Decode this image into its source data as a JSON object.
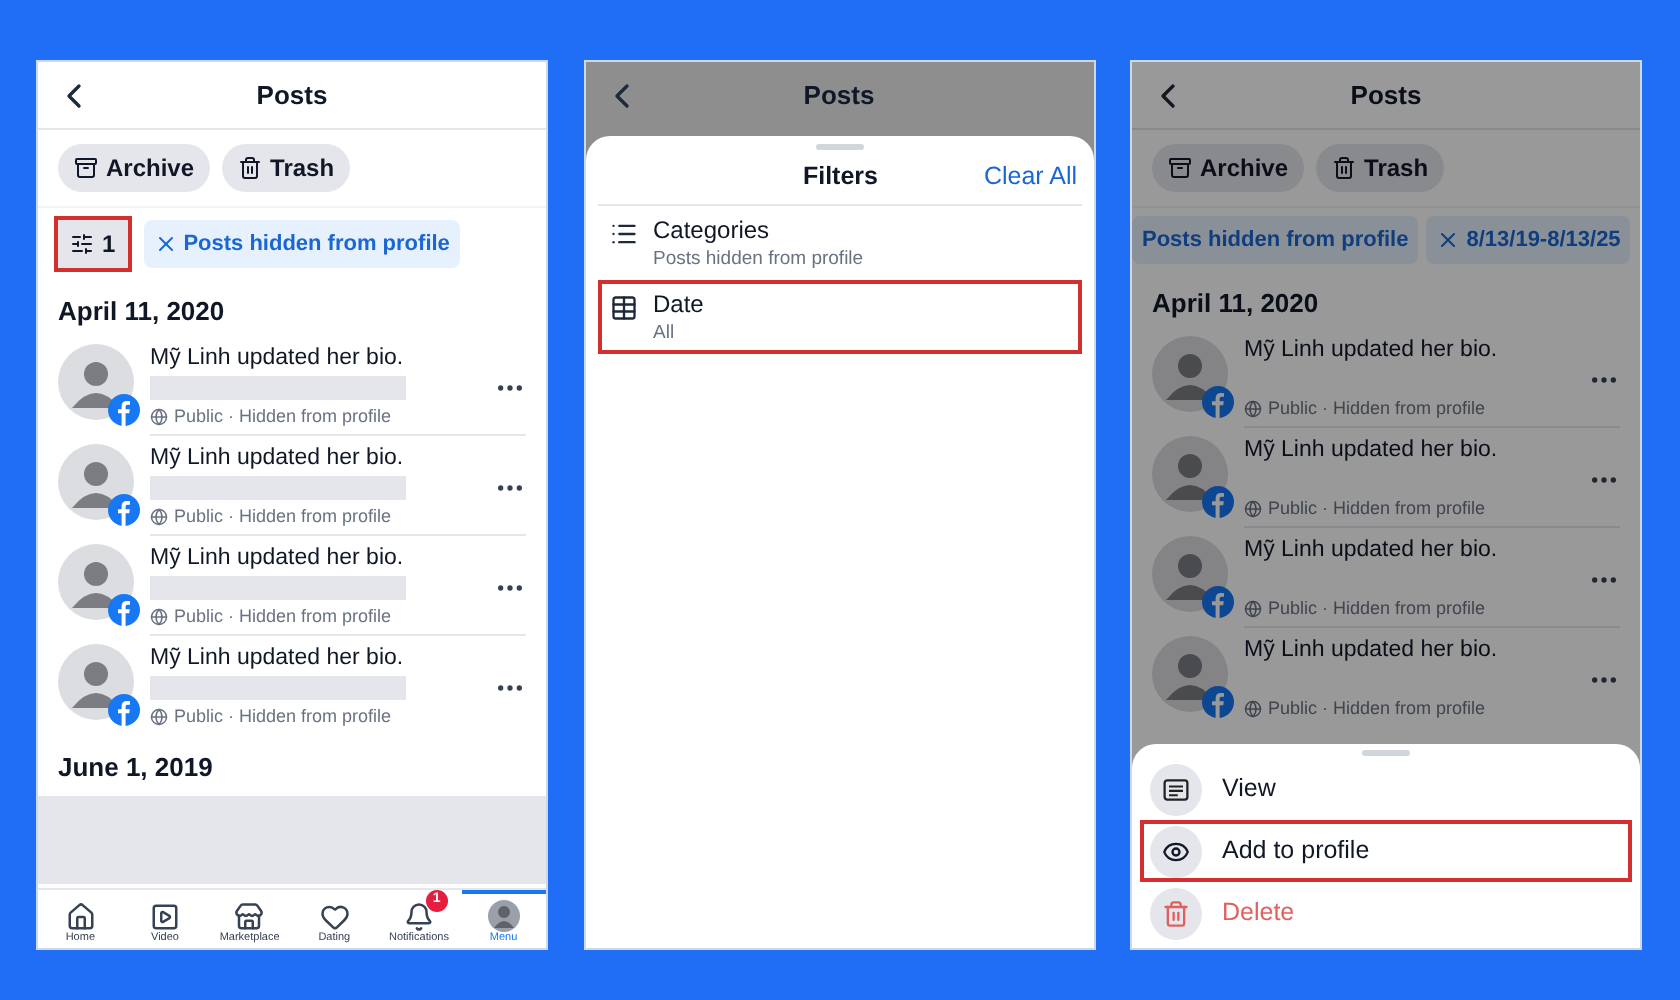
{
  "screen_1": {
    "title": "Posts",
    "action_chips": [
      "Archive",
      "Trash"
    ],
    "filter_button": {
      "count": "1",
      "highlighted": true
    },
    "filter_chips": [
      {
        "label": "Posts hidden from profile",
        "removable": true
      }
    ],
    "sections": [
      {
        "date": "April 11, 2020",
        "posts": [
          {
            "text": "Mỹ Linh updated her bio.",
            "meta": "Public · Hidden from profile",
            "redacted": true
          },
          {
            "text": "Mỹ Linh updated her bio.",
            "meta": "Public · Hidden from profile",
            "redacted": true
          },
          {
            "text": "Mỹ Linh updated her bio.",
            "meta": "Public · Hidden from profile",
            "redacted": true
          },
          {
            "text": "Mỹ Linh updated her bio.",
            "meta": "Public · Hidden from profile",
            "redacted": true
          }
        ]
      },
      {
        "date": "June 1, 2019",
        "loading": true
      }
    ],
    "nav": [
      {
        "label": "Home",
        "selected": false
      },
      {
        "label": "Video",
        "selected": false
      },
      {
        "label": "Marketplace",
        "selected": false
      },
      {
        "label": "Dating",
        "selected": false
      },
      {
        "label": "Notifications",
        "selected": false,
        "badge": "1"
      },
      {
        "label": "Menu",
        "selected": true
      }
    ]
  },
  "screen_2": {
    "title": "Posts",
    "sheet": {
      "title": "Filters",
      "action": "Clear All",
      "items": [
        {
          "label": "Categories",
          "value": "Posts hidden from profile",
          "highlighted": false
        },
        {
          "label": "Date",
          "value": "All",
          "highlighted": true
        }
      ]
    }
  },
  "screen_3": {
    "title": "Posts",
    "action_chips": [
      "Archive",
      "Trash"
    ],
    "filter_chips": [
      {
        "label": "Posts hidden from profile",
        "removable": false
      },
      {
        "label": "8/13/19-8/13/25",
        "removable": true
      }
    ],
    "sections": [
      {
        "date": "April 11, 2020",
        "posts": [
          {
            "text": "Mỹ Linh updated her bio.",
            "meta": "Public · Hidden from profile",
            "redacted": false
          },
          {
            "text": "Mỹ Linh updated her bio.",
            "meta": "Public · Hidden from profile",
            "redacted": false
          },
          {
            "text": "Mỹ Linh updated her bio.",
            "meta": "Public · Hidden from profile",
            "redacted": false
          },
          {
            "text": "Mỹ Linh updated her bio.",
            "meta": "Public · Hidden from profile",
            "redacted": false
          }
        ]
      }
    ],
    "menu": [
      {
        "label": "View",
        "kind": "normal",
        "highlighted": false
      },
      {
        "label": "Add to profile",
        "kind": "normal",
        "highlighted": true
      },
      {
        "label": "Delete",
        "kind": "destructive",
        "highlighted": false
      }
    ]
  }
}
